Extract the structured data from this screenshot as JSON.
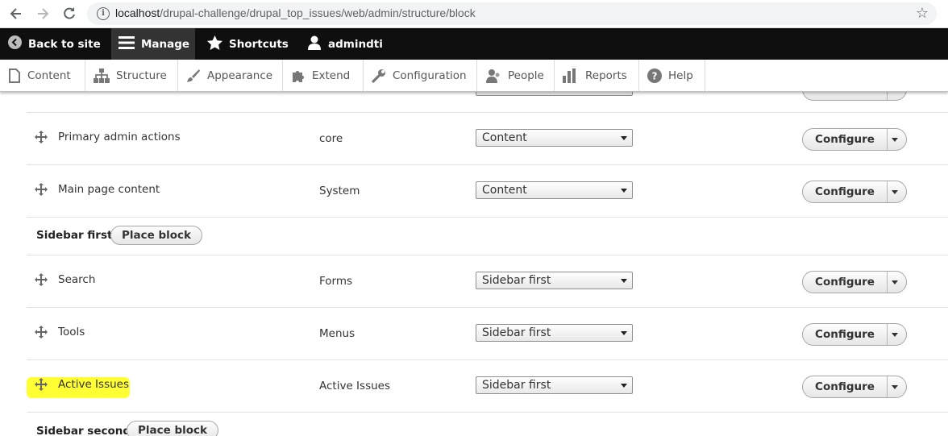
{
  "browser": {
    "url_host": "localhost",
    "url_path": "/drupal-challenge/drupal_top_issues/web/admin/structure/block",
    "icons": [
      "back-arrow-icon",
      "forward-arrow-icon",
      "reload-icon",
      "info-icon",
      "bookmark-star-icon"
    ]
  },
  "toolbar": {
    "back_to_site": "Back to site",
    "manage": "Manage",
    "shortcuts": "Shortcuts",
    "user": "admindti"
  },
  "tray": {
    "items": [
      "Content",
      "Structure",
      "Appearance",
      "Extend",
      "Configuration",
      "People",
      "Reports",
      "Help"
    ]
  },
  "blocks": {
    "primary_admin_actions": {
      "name": "Primary admin actions",
      "category": "core",
      "region": "Content",
      "configure": "Configure"
    },
    "main_page_content": {
      "name": "Main page content",
      "category": "System",
      "region": "Content",
      "configure": "Configure"
    },
    "search": {
      "name": "Search",
      "category": "Forms",
      "region": "Sidebar first",
      "configure": "Configure"
    },
    "tools": {
      "name": "Tools",
      "category": "Menus",
      "region": "Sidebar first",
      "configure": "Configure"
    },
    "active_issues": {
      "name": "Active Issues",
      "category": "Active Issues",
      "region": "Sidebar first",
      "configure": "Configure"
    }
  },
  "regions": {
    "sidebar_first": {
      "title": "Sidebar first",
      "place_block": "Place block"
    },
    "sidebar_second": {
      "title": "Sidebar second",
      "place_block": "Place block"
    }
  },
  "colors": {
    "toolbar_bg": "#0f0f0f",
    "highlight": "#ffff33"
  }
}
